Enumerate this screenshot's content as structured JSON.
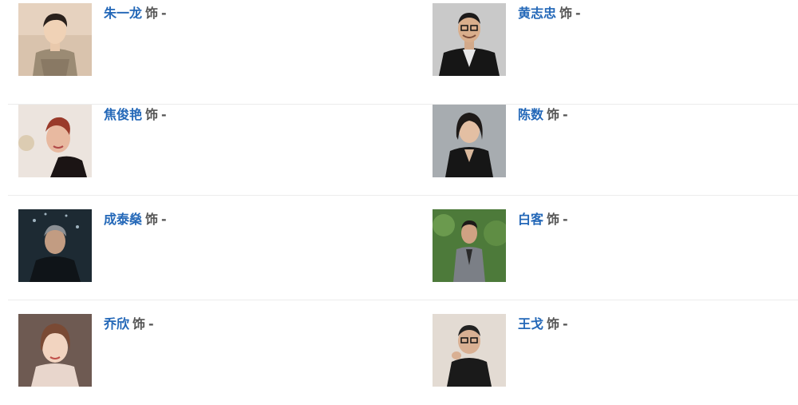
{
  "cast": [
    {
      "name": "朱一龙",
      "connector": "饰",
      "role": "-",
      "photo": "actor-photo-zhu-yilong"
    },
    {
      "name": "黄志忠",
      "connector": "饰",
      "role": "-",
      "photo": "actor-photo-huang-zhizhong"
    },
    {
      "name": "焦俊艳",
      "connector": "饰",
      "role": "-",
      "photo": "actor-photo-jiao-junyan"
    },
    {
      "name": "陈数",
      "connector": "饰",
      "role": "-",
      "photo": "actor-photo-chen-shu"
    },
    {
      "name": "成泰燊",
      "connector": "饰",
      "role": "-",
      "photo": "actor-photo-cheng-taishen"
    },
    {
      "name": "白客",
      "connector": "饰",
      "role": "-",
      "photo": "actor-photo-bai-ke"
    },
    {
      "name": "乔欣",
      "connector": "饰",
      "role": "-",
      "photo": "actor-photo-qiao-xin"
    },
    {
      "name": "王戈",
      "connector": "饰",
      "role": "-",
      "photo": "actor-photo-wang-ge"
    }
  ],
  "colors": {
    "name_link": "#2468b8",
    "role_text": "#555555",
    "divider": "#ececec"
  }
}
